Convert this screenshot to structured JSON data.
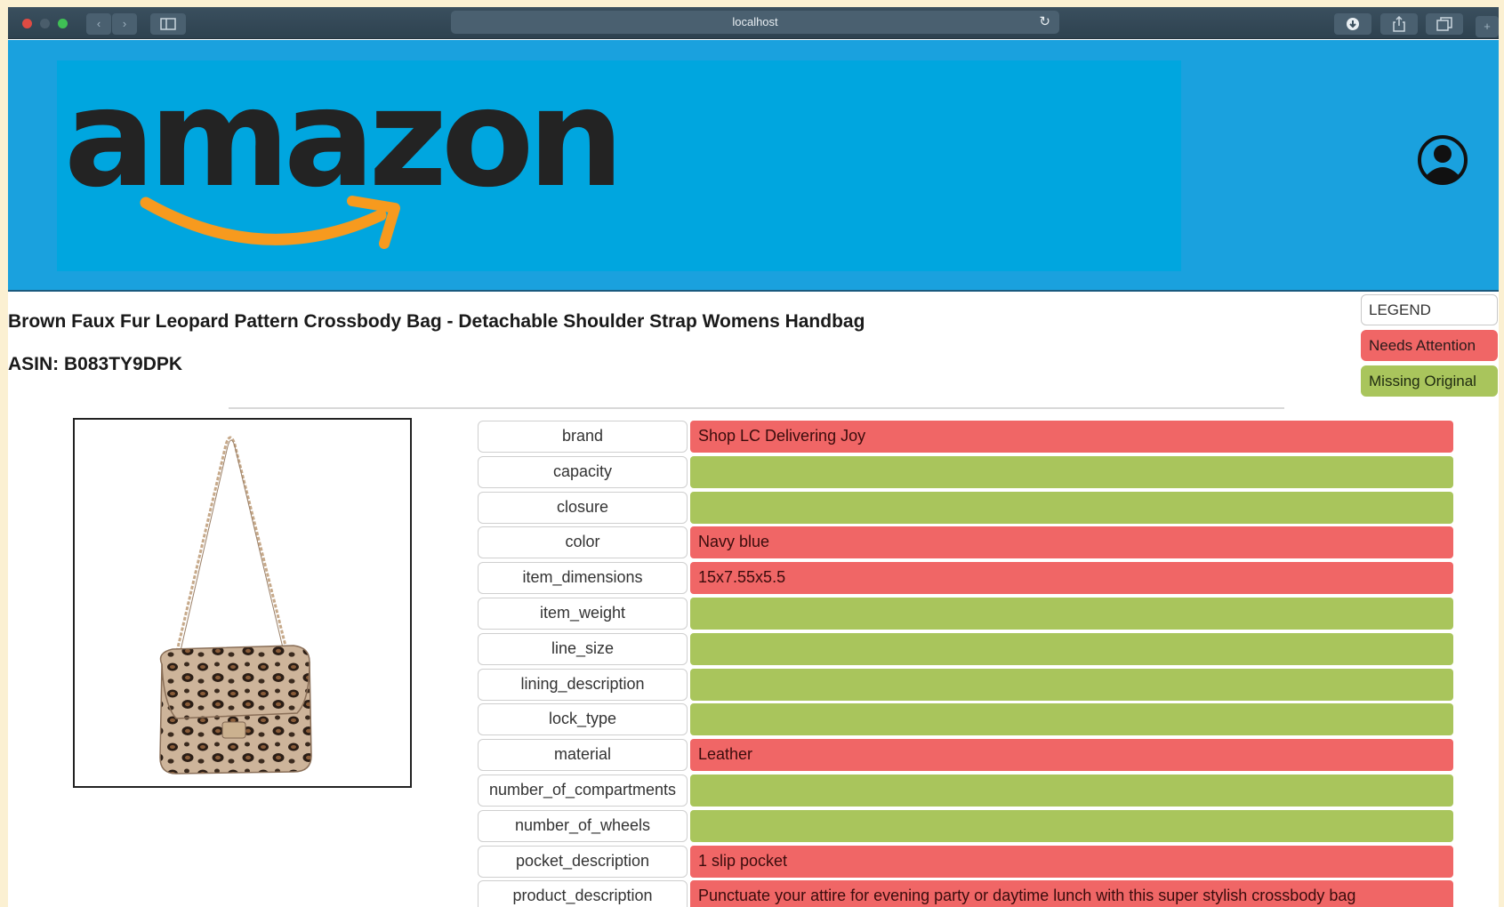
{
  "browser": {
    "address": "localhost"
  },
  "header": {
    "logo_text": "amazon",
    "brand_bg": "#1aa1de",
    "logo_bg": "#00a6df",
    "smile_color": "#f79a1e"
  },
  "product": {
    "title": "Brown Faux Fur Leopard Pattern Crossbody Bag - Detachable Shoulder Strap Womens Handbag",
    "asin_label": "ASIN: B083TY9DPK"
  },
  "legend": {
    "title": "LEGEND",
    "needs_attention": "Needs Attention",
    "missing_original": "Missing Original",
    "needs_attention_color": "#f06666",
    "missing_original_color": "#a9c55c"
  },
  "attributes": [
    {
      "key": "brand",
      "value": "Shop LC Delivering Joy",
      "status": "red"
    },
    {
      "key": "capacity",
      "value": "",
      "status": "green"
    },
    {
      "key": "closure",
      "value": "",
      "status": "green"
    },
    {
      "key": "color",
      "value": "Navy blue",
      "status": "red"
    },
    {
      "key": "item_dimensions",
      "value": "15x7.55x5.5",
      "status": "red"
    },
    {
      "key": "item_weight",
      "value": "",
      "status": "green"
    },
    {
      "key": "line_size",
      "value": "",
      "status": "green"
    },
    {
      "key": "lining_description",
      "value": "",
      "status": "green"
    },
    {
      "key": "lock_type",
      "value": "",
      "status": "green"
    },
    {
      "key": "material",
      "value": "Leather",
      "status": "red"
    },
    {
      "key": "number_of_compartments",
      "value": "",
      "status": "green"
    },
    {
      "key": "number_of_wheels",
      "value": "",
      "status": "green"
    },
    {
      "key": "pocket_description",
      "value": "1 slip pocket",
      "status": "red"
    },
    {
      "key": "product_description",
      "value": "Punctuate your attire for evening party or daytime lunch with this super stylish crossbody bag",
      "status": "red"
    }
  ]
}
